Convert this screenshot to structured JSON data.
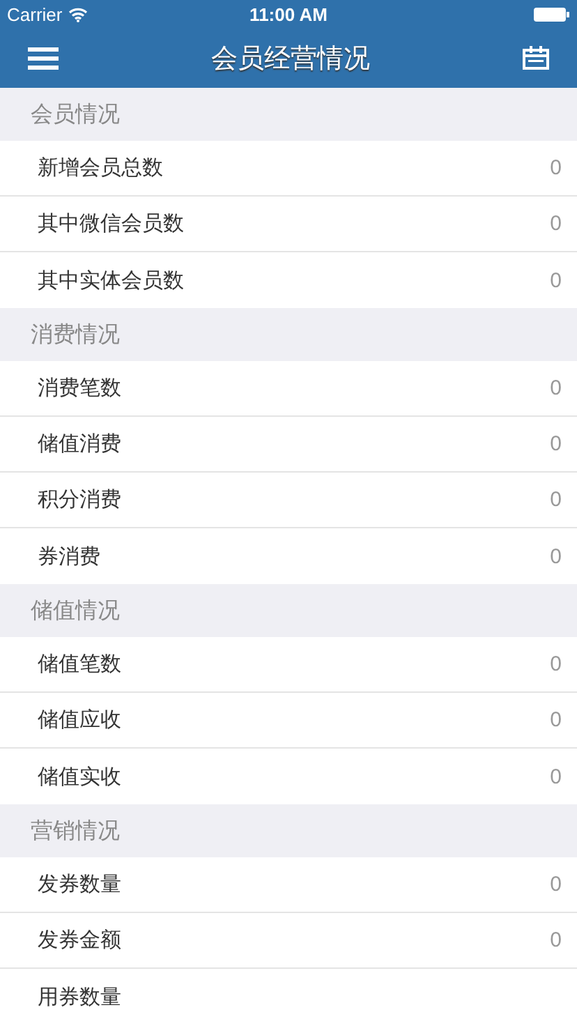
{
  "status_bar": {
    "carrier": "Carrier",
    "time": "11:00 AM"
  },
  "nav": {
    "title": "会员经营情况"
  },
  "sections": [
    {
      "title": "会员情况",
      "rows": [
        {
          "label": "新增会员总数",
          "value": "0"
        },
        {
          "label": "其中微信会员数",
          "value": "0"
        },
        {
          "label": "其中实体会员数",
          "value": "0"
        }
      ]
    },
    {
      "title": "消费情况",
      "rows": [
        {
          "label": "消费笔数",
          "value": "0"
        },
        {
          "label": "储值消费",
          "value": "0"
        },
        {
          "label": "积分消费",
          "value": "0"
        },
        {
          "label": "券消费",
          "value": "0"
        }
      ]
    },
    {
      "title": "储值情况",
      "rows": [
        {
          "label": "储值笔数",
          "value": "0"
        },
        {
          "label": "储值应收",
          "value": "0"
        },
        {
          "label": "储值实收",
          "value": "0"
        }
      ]
    },
    {
      "title": "营销情况",
      "rows": [
        {
          "label": "发券数量",
          "value": "0"
        },
        {
          "label": "发券金额",
          "value": "0"
        },
        {
          "label": "用券数量"
        }
      ]
    }
  ]
}
